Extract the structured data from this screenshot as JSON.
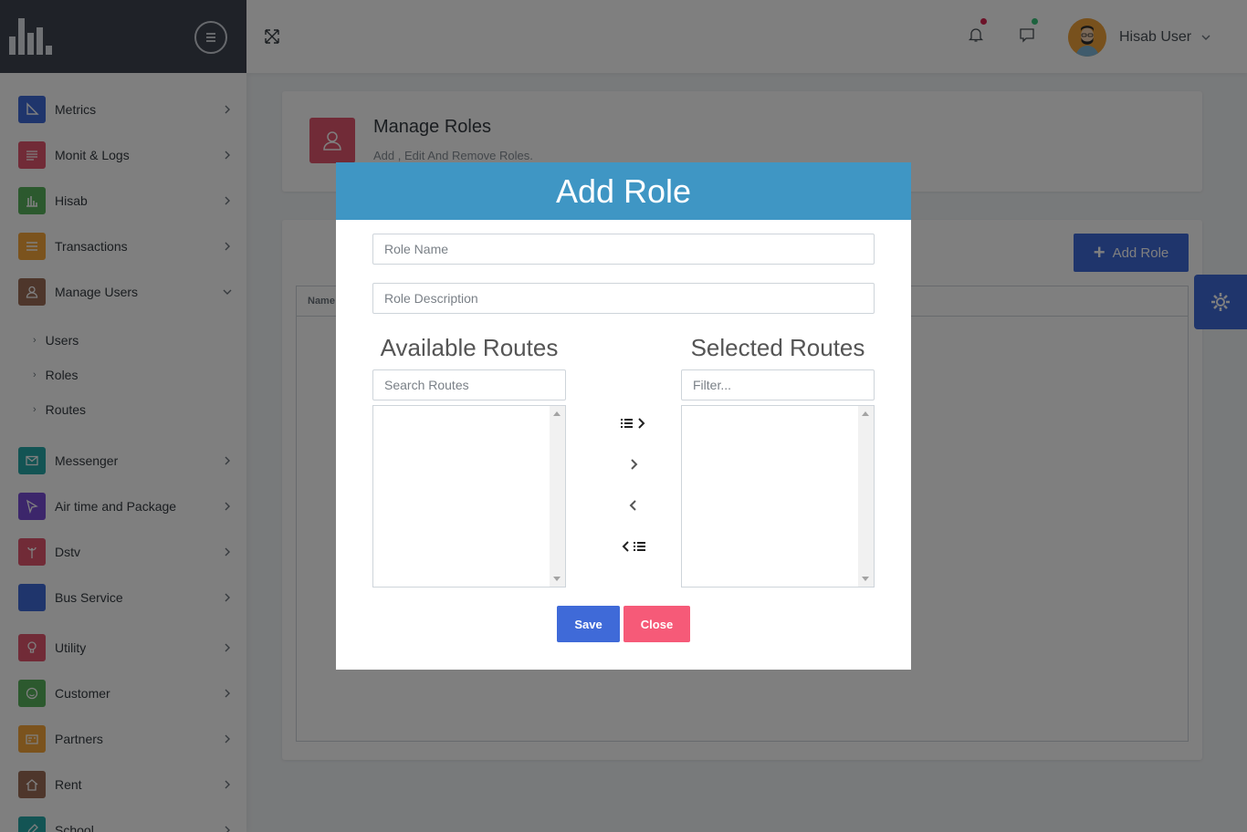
{
  "header": {
    "user_name": "Hisab User",
    "colors": {
      "notif_dot": "#d92550",
      "chat_dot": "#3ac47d"
    }
  },
  "sidebar": {
    "items": [
      {
        "label": "Metrics",
        "icon": "ruler-icon",
        "color": "#3f6ad8"
      },
      {
        "label": "Monit & Logs",
        "icon": "list-icon",
        "color": "#e2566f"
      },
      {
        "label": "Hisab",
        "icon": "bar-chart-icon",
        "color": "#58b25c"
      },
      {
        "label": "Transactions",
        "icon": "menu-icon",
        "color": "#f7a73a"
      },
      {
        "label": "Manage Users",
        "icon": "user-icon",
        "color": "#9c6c57"
      },
      {
        "label": "Messenger",
        "icon": "mail-icon",
        "color": "#27a8a8"
      },
      {
        "label": "Air time and Package",
        "icon": "cursor-icon",
        "color": "#794cd6"
      },
      {
        "label": "Dstv",
        "icon": "antenna-icon",
        "color": "#e2566f"
      },
      {
        "label": "Bus Service",
        "icon": "bus-icon",
        "color": "#3f6ad8"
      },
      {
        "label": "Utility",
        "icon": "bulb-icon",
        "color": "#e2566f"
      },
      {
        "label": "Customer",
        "icon": "smile-icon",
        "color": "#58b25c"
      },
      {
        "label": "Partners",
        "icon": "id-card-icon",
        "color": "#f7a73a"
      },
      {
        "label": "Rent",
        "icon": "home-icon",
        "color": "#9c6c57"
      },
      {
        "label": "School",
        "icon": "edit-icon",
        "color": "#27a8a8"
      }
    ],
    "sub_items": [
      "Users",
      "Roles",
      "Routes"
    ]
  },
  "page": {
    "title": "Manage Roles",
    "subtitle": "Add , Edit And Remove Roles.",
    "add_button_label": "Add Role",
    "table_header": "Name"
  },
  "modal": {
    "title": "Add Role",
    "role_name_placeholder": "Role Name",
    "role_description_placeholder": "Role Description",
    "available_title": "Available Routes",
    "selected_title": "Selected Routes",
    "search_placeholder": "Search Routes",
    "filter_placeholder": "Filter...",
    "save_label": "Save",
    "close_label": "Close"
  }
}
